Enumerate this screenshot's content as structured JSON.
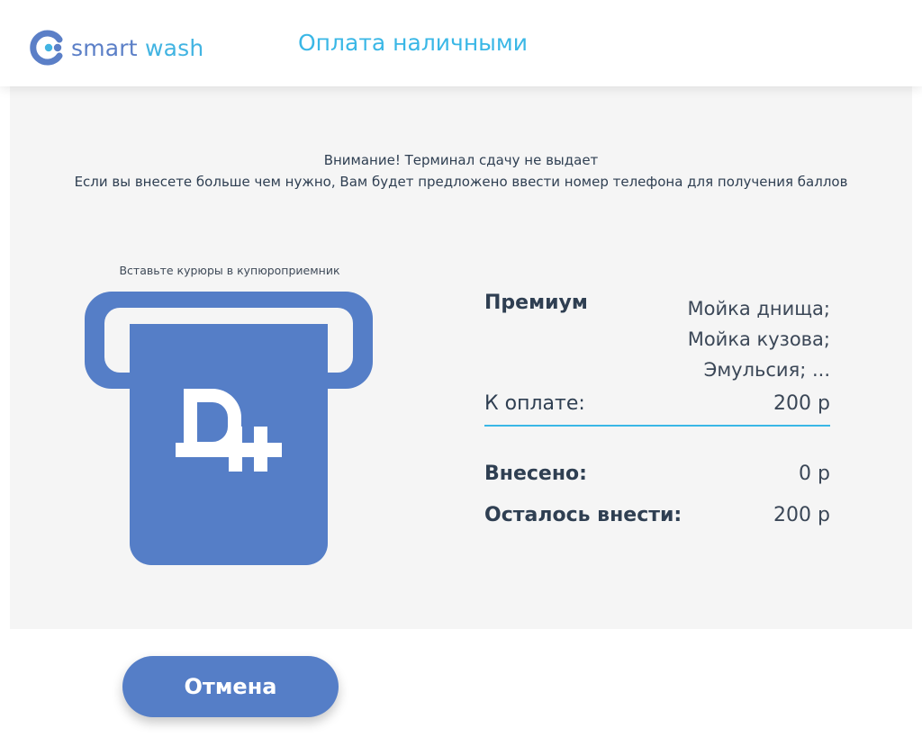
{
  "header": {
    "logo": {
      "word1": "smart",
      "word2": "wash",
      "icon": "smart-wash-logo-icon"
    },
    "title": "Оплата наличными"
  },
  "notice": {
    "line1": "Внимание! Терминал сдачу не выдает",
    "line2": "Если вы внесете больше чем нужно, Вам будет предложено ввести номер телефона для получения баллов"
  },
  "bill_acceptor": {
    "label": "Вставьте курюры в купюроприемник",
    "icon": "bill-acceptor-ruble-icon"
  },
  "order": {
    "service_name": "Премиум",
    "service_items": [
      "Мойка днища;",
      "Мойка кузова;",
      "Эмульсия; ..."
    ],
    "to_pay_label": "К оплате:",
    "to_pay_value": "200 р",
    "deposited_label": "Внесено:",
    "deposited_value": "0 р",
    "remaining_label": "Осталось внести:",
    "remaining_value": "200 р"
  },
  "footer": {
    "cancel_label": "Отмена"
  },
  "colors": {
    "brand_blue": "#557ec7",
    "accent_cyan": "#3ab7e6",
    "panel_bg": "#f5f5f5",
    "text_dark": "#2f3f52"
  }
}
